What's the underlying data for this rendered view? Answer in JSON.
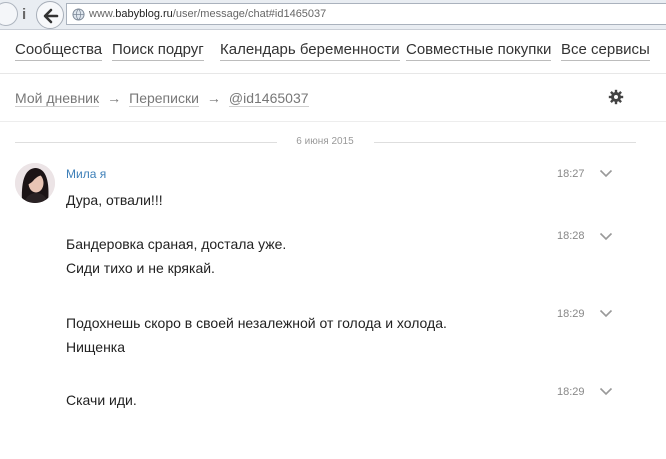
{
  "browser": {
    "url_prefix": "www.",
    "url_domain": "babyblog.ru",
    "url_path": "/user/message/chat#id1465037",
    "nav_i": "i"
  },
  "site_nav": [
    {
      "label": "Сообщества"
    },
    {
      "label": "Поиск подруг"
    },
    {
      "label": "Календарь беременности"
    },
    {
      "label": "Совместные покупки"
    },
    {
      "label": "Все сервисы"
    }
  ],
  "breadcrumb": {
    "diary": "Мой дневник",
    "sep": "→",
    "chats": "Переписки",
    "current": "@id1465037"
  },
  "chat": {
    "date": "6 июня 2015",
    "author": "Мила я",
    "messages": [
      {
        "time": "18:27",
        "lines": [
          "Дура, отвали!!!"
        ]
      },
      {
        "time": "18:28",
        "lines": [
          "Бандеровка сраная, достала уже.",
          "Сиди тихо и не крякай."
        ]
      },
      {
        "time": "18:29",
        "lines": [
          "Подохнешь скоро в своей незалежной от голода и холода.",
          "Нищенка"
        ]
      },
      {
        "time": "18:29",
        "lines": [
          "Скачи иди."
        ]
      }
    ]
  },
  "colors": {
    "author_link": "#3d7fb8",
    "text": "#222222",
    "muted": "#777777"
  },
  "icons": [
    "back-arrow-icon",
    "globe-icon",
    "gear-icon",
    "chevron-down-icon",
    "avatar-photo"
  ]
}
